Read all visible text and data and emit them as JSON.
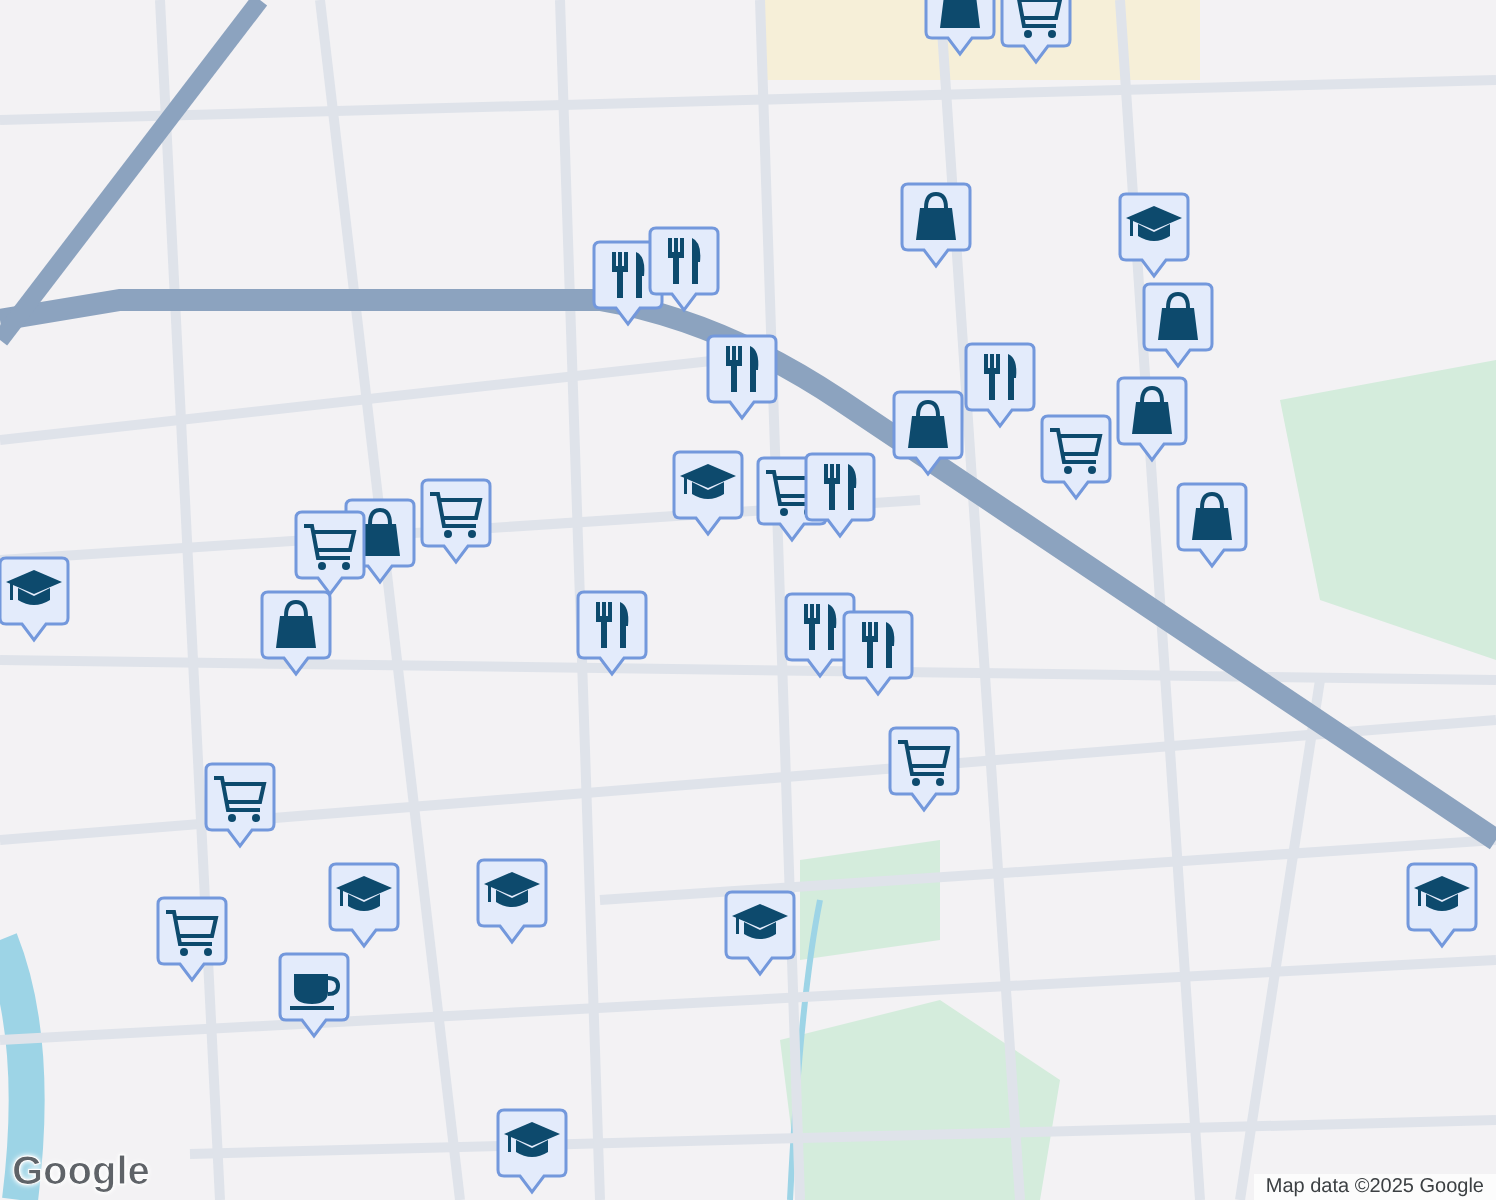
{
  "map": {
    "markers": [
      {
        "kind": "bag"
      },
      {
        "kind": "cart"
      },
      {
        "kind": "bag"
      },
      {
        "kind": "school"
      },
      {
        "kind": "restaurant"
      },
      {
        "kind": "restaurant"
      },
      {
        "kind": "restaurant"
      },
      {
        "kind": "bag"
      },
      {
        "kind": "restaurant"
      },
      {
        "kind": "bag"
      },
      {
        "kind": "bag"
      },
      {
        "kind": "cart"
      },
      {
        "kind": "school"
      },
      {
        "kind": "cart"
      },
      {
        "kind": "restaurant"
      },
      {
        "kind": "bag"
      },
      {
        "kind": "cart"
      },
      {
        "kind": "bag"
      },
      {
        "kind": "cart"
      },
      {
        "kind": "school"
      },
      {
        "kind": "bag"
      },
      {
        "kind": "restaurant"
      },
      {
        "kind": "restaurant"
      },
      {
        "kind": "restaurant"
      },
      {
        "kind": "cart"
      },
      {
        "kind": "cart"
      },
      {
        "kind": "school"
      },
      {
        "kind": "school"
      },
      {
        "kind": "school"
      },
      {
        "kind": "cart"
      },
      {
        "kind": "cafe"
      },
      {
        "kind": "school"
      },
      {
        "kind": "school"
      }
    ]
  },
  "logo": "Google",
  "attribution": "Map data ©2025 Google"
}
